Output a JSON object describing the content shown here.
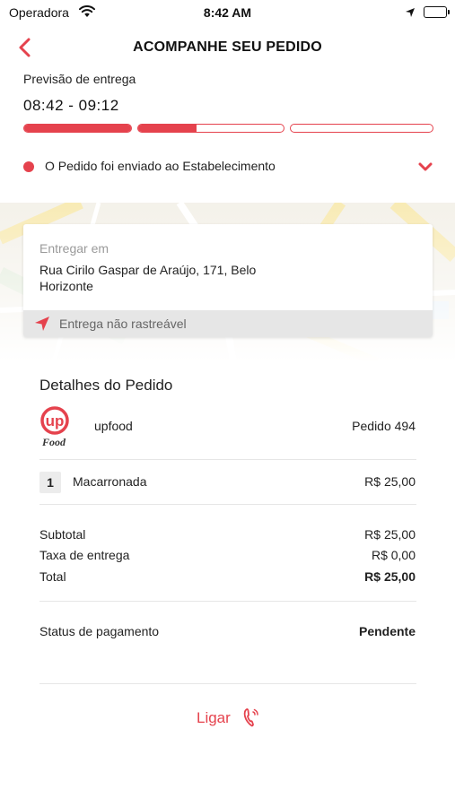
{
  "status_bar": {
    "carrier": "Operadora",
    "time": "8:42 AM"
  },
  "header": {
    "title": "ACOMPANHE SEU PEDIDO"
  },
  "eta": {
    "label": "Previsão de entrega",
    "value": "08:42 - 09:12"
  },
  "progress": {
    "segments": [
      1.0,
      0.4,
      0.0
    ]
  },
  "order_status": {
    "text": "O Pedido foi enviado ao Estabelecimento"
  },
  "delivery": {
    "label": "Entregar em",
    "address": "Rua Cirilo Gaspar de Araújo, 171,  Belo Horizonte",
    "tracking": "Entrega não rastreável"
  },
  "details": {
    "title": "Detalhes do Pedido",
    "store_name": "upfood",
    "order_number": "Pedido 494",
    "logo_text_top": "up",
    "logo_text_bottom": "Food",
    "items": [
      {
        "qty": "1",
        "name": "Macarronada",
        "price": "R$ 25,00"
      }
    ],
    "subtotal_label": "Subtotal",
    "subtotal_value": "R$ 25,00",
    "delivery_fee_label": "Taxa de entrega",
    "delivery_fee_value": "R$ 0,00",
    "total_label": "Total",
    "total_value": "R$ 25,00",
    "payment_label": "Status de pagamento",
    "payment_value": "Pendente"
  },
  "actions": {
    "call_label": "Ligar"
  },
  "colors": {
    "accent": "#e5424d",
    "muted": "#9a9a9a",
    "track_bar": "#e6e6e6"
  }
}
